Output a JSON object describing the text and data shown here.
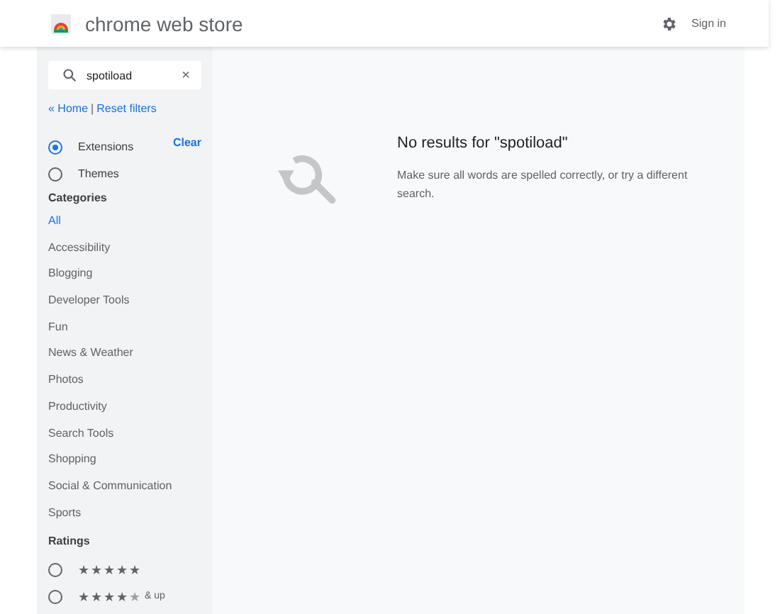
{
  "header": {
    "title": "chrome web store",
    "sign_in": "Sign in"
  },
  "sidebar": {
    "search": {
      "value": "spotiload",
      "clear": "×"
    },
    "links": [
      "« Home",
      "Reset filters"
    ],
    "separator": "|",
    "types": [
      {
        "label": "Extensions",
        "selected": true
      },
      {
        "label": "Themes",
        "selected": false
      }
    ],
    "clear": "Clear",
    "categories_title": "Categories",
    "categories": [
      {
        "label": "All",
        "selected": true
      },
      {
        "label": "Accessibility",
        "selected": false
      },
      {
        "label": "Blogging",
        "selected": false
      },
      {
        "label": "Developer Tools",
        "selected": false
      },
      {
        "label": "Fun",
        "selected": false
      },
      {
        "label": "News & Weather",
        "selected": false
      },
      {
        "label": "Photos",
        "selected": false
      },
      {
        "label": "Productivity",
        "selected": false
      },
      {
        "label": "Search Tools",
        "selected": false
      },
      {
        "label": "Shopping",
        "selected": false
      },
      {
        "label": "Social & Communication",
        "selected": false
      },
      {
        "label": "Sports",
        "selected": false
      }
    ],
    "ratings_title": "Ratings",
    "ratings": [
      {
        "stars": 5,
        "selected": false
      },
      {
        "stars": 4,
        "selected": false,
        "suffix": "& up"
      }
    ]
  },
  "results": {
    "title": "No results for \"spotiload\"",
    "message": "Make sure all words are spelled correctly, or try a different search."
  }
}
